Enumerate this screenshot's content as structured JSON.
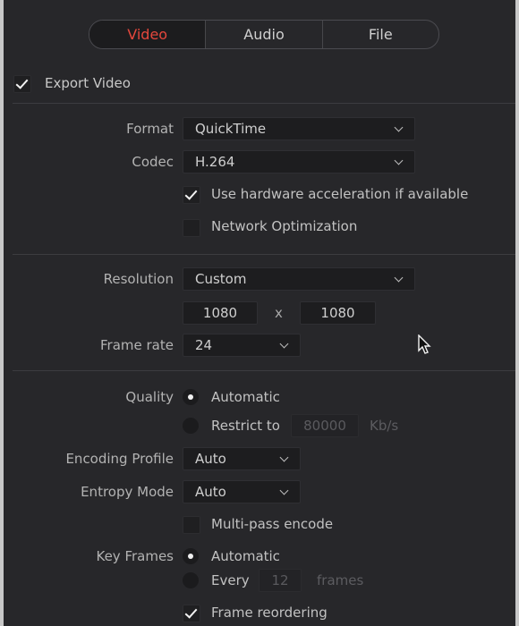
{
  "tabs": [
    {
      "label": "Video",
      "active": true
    },
    {
      "label": "Audio",
      "active": false
    },
    {
      "label": "File",
      "active": false
    }
  ],
  "export_video": {
    "label": "Export Video",
    "checked": true
  },
  "format": {
    "label": "Format",
    "value": "QuickTime"
  },
  "codec": {
    "label": "Codec",
    "value": "H.264"
  },
  "hw_accel": {
    "label": "Use hardware acceleration if available",
    "checked": true
  },
  "network_opt": {
    "label": "Network Optimization",
    "checked": false
  },
  "resolution": {
    "label": "Resolution",
    "value": "Custom",
    "width": "1080",
    "x": "x",
    "height": "1080"
  },
  "frame_rate": {
    "label": "Frame rate",
    "value": "24"
  },
  "quality": {
    "label": "Quality",
    "automatic": "Automatic",
    "restrict_label": "Restrict to",
    "restrict_value": "80000",
    "restrict_unit": "Kb/s",
    "selected": "automatic"
  },
  "encoding_profile": {
    "label": "Encoding Profile",
    "value": "Auto"
  },
  "entropy_mode": {
    "label": "Entropy Mode",
    "value": "Auto"
  },
  "multipass": {
    "label": "Multi-pass encode",
    "checked": false
  },
  "key_frames": {
    "label": "Key Frames",
    "automatic": "Automatic",
    "every_label": "Every",
    "every_value": "12",
    "every_unit": "frames",
    "selected": "automatic"
  },
  "frame_reordering": {
    "label": "Frame reordering",
    "checked": true
  },
  "colors": {
    "accent": "#e4473c",
    "panel": "#27272a",
    "field": "#1d1d1f"
  }
}
